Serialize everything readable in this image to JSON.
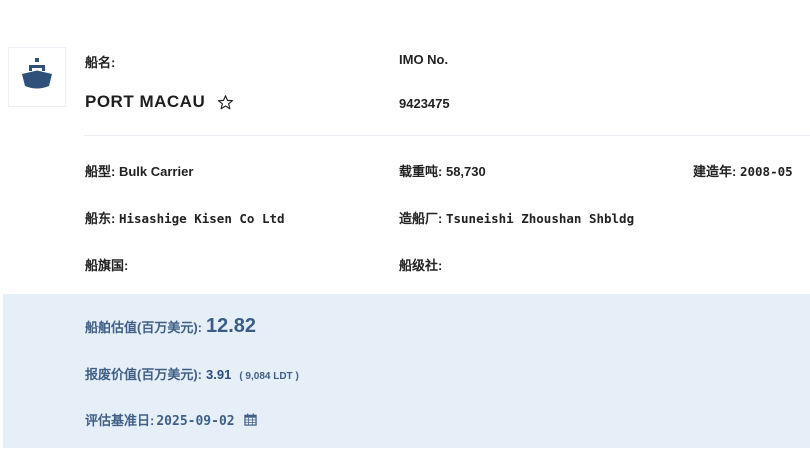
{
  "vessel": {
    "name_label": "船名:",
    "name": "PORT MACAU",
    "imo_label": "IMO No.",
    "imo": "9423475"
  },
  "details": {
    "type_label": "船型:",
    "type_value": "Bulk Carrier",
    "dwt_label": "载重吨:",
    "dwt_value": "58,730",
    "built_label": "建造年:",
    "built_value": "2008-05",
    "owner_label": "船东:",
    "owner_value": "Hisashige Kisen Co Ltd",
    "builder_label": "造船厂:",
    "builder_value": "Tsuneishi Zhoushan Shbldg",
    "flag_label": "船旗国:",
    "flag_value": "",
    "class_label": "船级社:",
    "class_value": ""
  },
  "valuation": {
    "value_label": "船舶估值(百万美元):",
    "value": "12.82",
    "scrap_label": "报废价值(百万美元):",
    "scrap_value": "3.91",
    "scrap_note": "( 9,084 LDT )",
    "date_label": "评估基准日:",
    "date_value": "2025-09-02"
  },
  "icons": {
    "logo": "ship-icon",
    "favorite": "star-outline-icon",
    "date_picker": "calendar-icon"
  },
  "colors": {
    "brand": "#2f5079",
    "valuation_bg": "#e6eef7",
    "valuation_text": "#3f5f86"
  }
}
